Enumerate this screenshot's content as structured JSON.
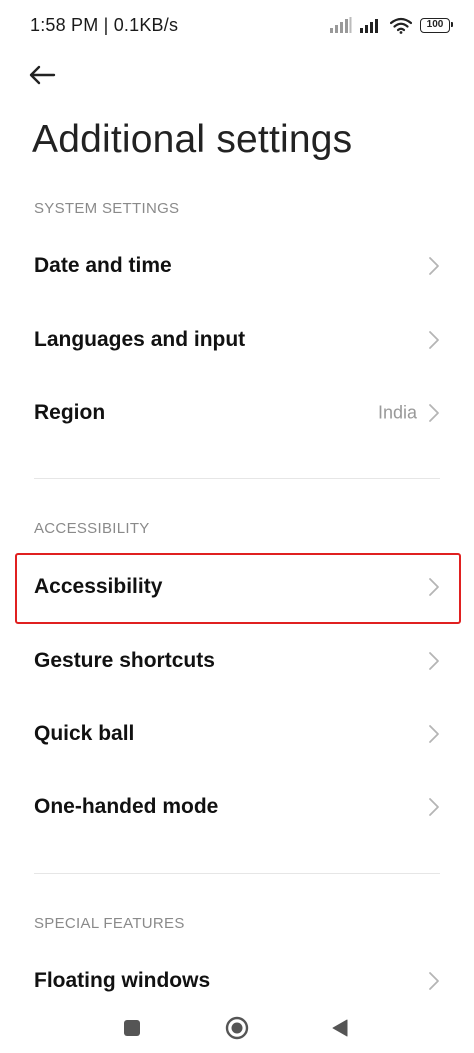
{
  "status_bar": {
    "time_and_speed": "1:58 PM | 0.1KB/s",
    "battery": "100"
  },
  "header": {
    "back_icon": "arrow-left-icon",
    "title": "Additional settings"
  },
  "sections": [
    {
      "header": "SYSTEM SETTINGS",
      "items": [
        {
          "label": "Date and time",
          "value": ""
        },
        {
          "label": "Languages and input",
          "value": ""
        },
        {
          "label": "Region",
          "value": "India"
        }
      ]
    },
    {
      "header": "ACCESSIBILITY",
      "items": [
        {
          "label": "Accessibility",
          "value": ""
        },
        {
          "label": "Gesture shortcuts",
          "value": ""
        },
        {
          "label": "Quick ball",
          "value": ""
        },
        {
          "label": "One-handed mode",
          "value": ""
        }
      ]
    },
    {
      "header": "SPECIAL FEATURES",
      "items": [
        {
          "label": "Floating windows",
          "value": ""
        }
      ]
    }
  ],
  "highlight_color": "#e02020",
  "nav_bar": {
    "recents_icon": "square-icon",
    "home_icon": "circle-icon",
    "back_icon": "triangle-back-icon"
  }
}
